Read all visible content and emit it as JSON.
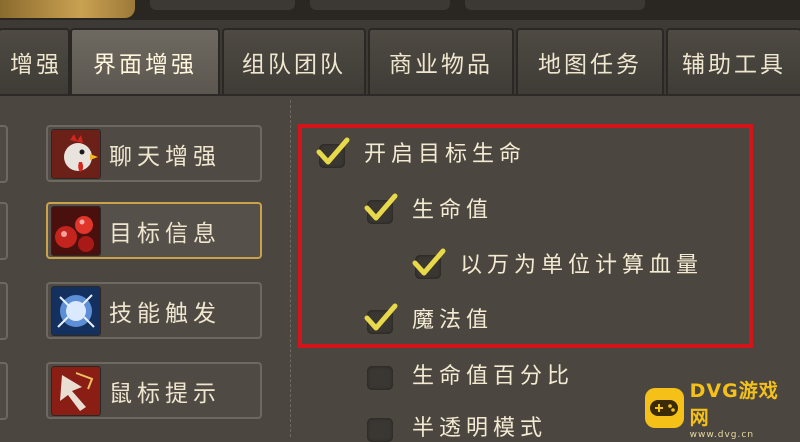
{
  "tabs": [
    {
      "label": "增强",
      "active": false
    },
    {
      "label": "界面增强",
      "active": true
    },
    {
      "label": "组队团队",
      "active": false
    },
    {
      "label": "商业物品",
      "active": false
    },
    {
      "label": "地图任务",
      "active": false
    },
    {
      "label": "辅助工具",
      "active": false
    }
  ],
  "sidebar": {
    "items": [
      {
        "label": "聊天增强",
        "icon": "rooster-icon",
        "selected": false
      },
      {
        "label": "目标信息",
        "icon": "target-info-icon",
        "selected": true
      },
      {
        "label": "技能触发",
        "icon": "skill-trigger-icon",
        "selected": false
      },
      {
        "label": "鼠标提示",
        "icon": "mouse-tip-icon",
        "selected": false
      }
    ]
  },
  "options": [
    {
      "label": "开启目标生命",
      "checked": true
    },
    {
      "label": "生命值",
      "checked": true
    },
    {
      "label": "以万为单位计算血量",
      "checked": true
    },
    {
      "label": "魔法值",
      "checked": true
    },
    {
      "label": "生命值百分比",
      "checked": false
    },
    {
      "label": "半透明模式",
      "checked": false
    }
  ],
  "watermark": {
    "main": "DVG游戏网",
    "sub": "www.dvg.cn"
  },
  "colors": {
    "highlight": "#d4141b",
    "check": "#e8d94a",
    "accent": "#c9a24a"
  }
}
